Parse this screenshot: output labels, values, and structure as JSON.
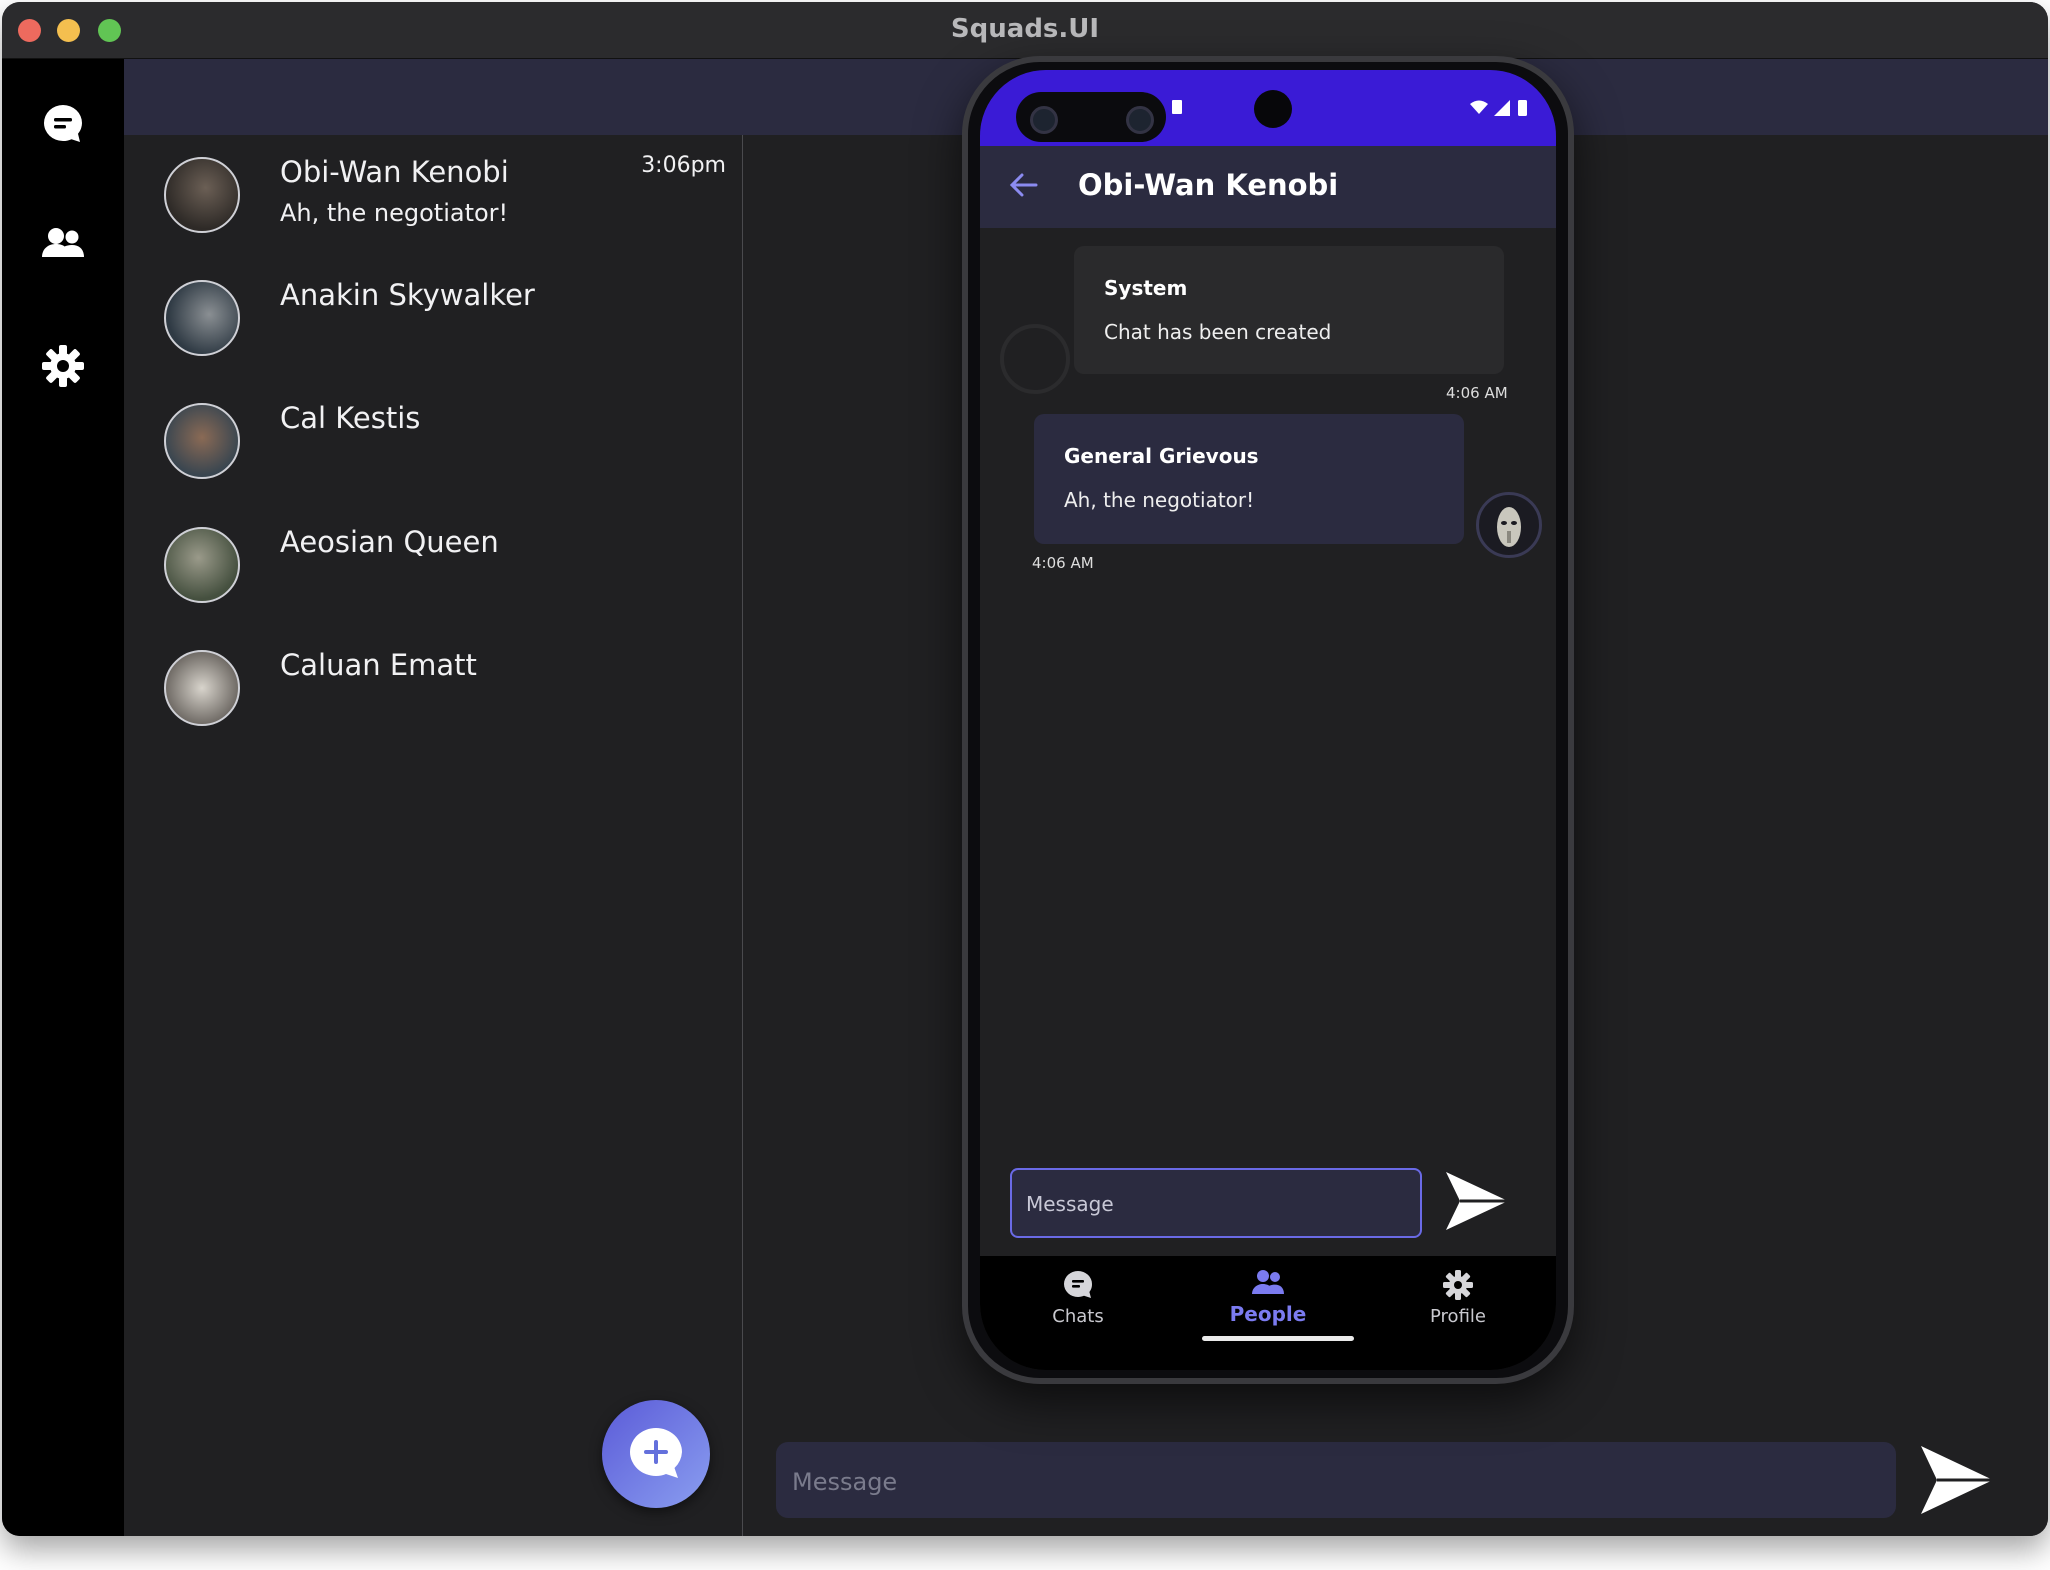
{
  "window": {
    "title": "Squads.UI"
  },
  "rail": {
    "items": [
      {
        "icon": "chat-icon"
      },
      {
        "icon": "people-icon"
      },
      {
        "icon": "gear-icon"
      }
    ]
  },
  "contacts": [
    {
      "name": "Obi-Wan Kenobi",
      "message": "Ah, the negotiator!",
      "time": "3:06pm"
    },
    {
      "name": "Anakin Skywalker",
      "message": "",
      "time": ""
    },
    {
      "name": "Cal Kestis",
      "message": "",
      "time": ""
    },
    {
      "name": "Aeosian Queen",
      "message": "",
      "time": ""
    },
    {
      "name": "Caluan Ematt",
      "message": "",
      "time": ""
    }
  ],
  "compose": {
    "placeholder": "Message"
  },
  "phone": {
    "header_title": "Obi-Wan Kenobi",
    "messages": [
      {
        "sender": "System",
        "text": "Chat  has been created",
        "time": "4:06 AM"
      },
      {
        "sender": "General Grievous",
        "text": "Ah, the negotiator!",
        "time": "4:06 AM"
      }
    ],
    "input_placeholder": "Message",
    "nav": [
      {
        "label": "Chats",
        "icon": "chat-bubble-icon",
        "active": false
      },
      {
        "label": "People",
        "icon": "people-icon",
        "active": true
      },
      {
        "label": "Profile",
        "icon": "gear-icon",
        "active": false
      }
    ]
  },
  "colors": {
    "accent": "#3a1bd6",
    "panel": "#2b2b40",
    "background": "#202022",
    "active_nav": "#7b7bf0"
  }
}
